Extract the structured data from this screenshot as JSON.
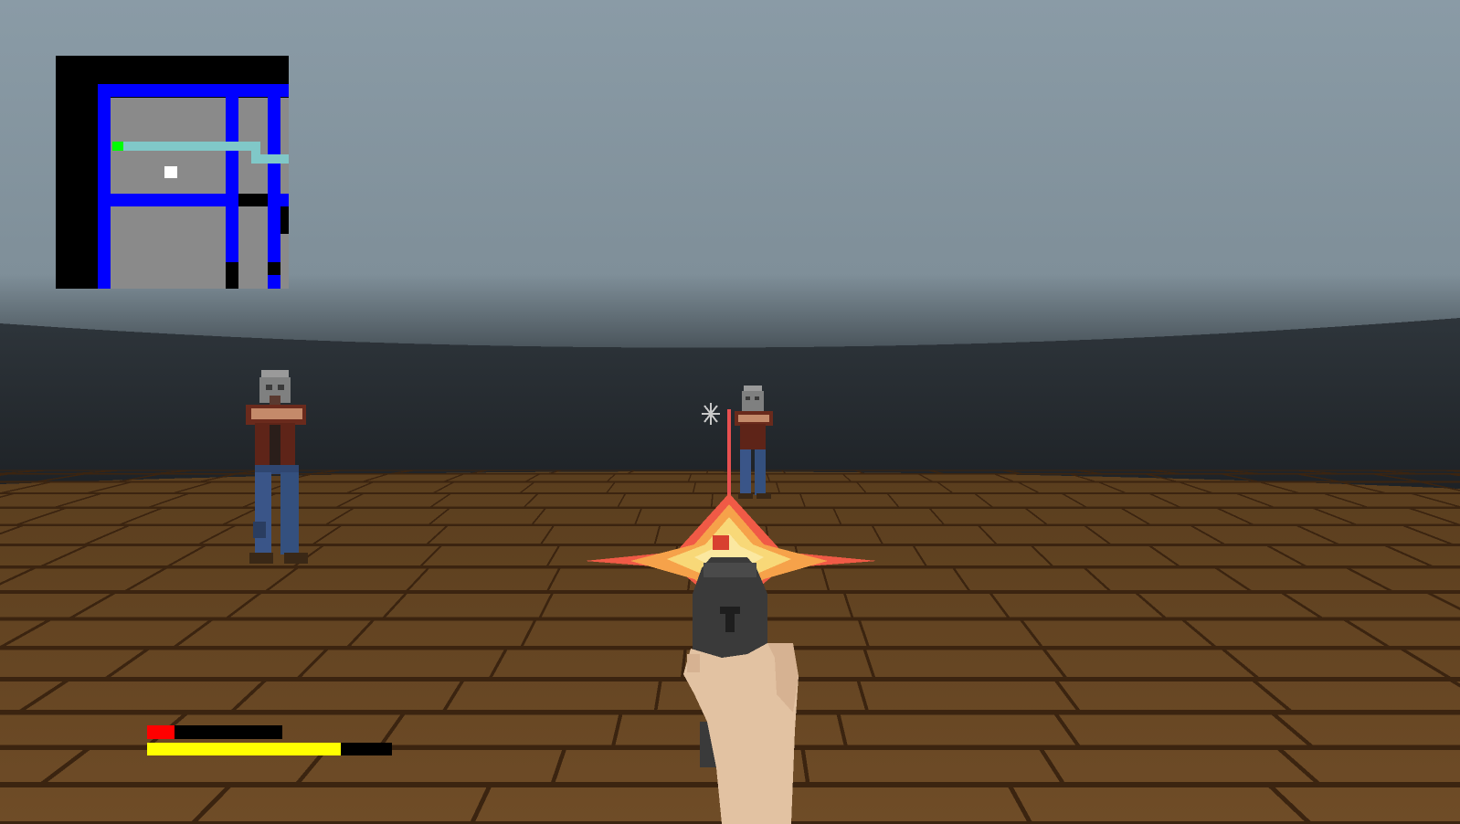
{
  "window": {
    "title": ""
  },
  "colors": {
    "sky": "#8fa0aa",
    "wall": "#2a2f34",
    "floor": "#6b4a25",
    "floor_lines": "#3b2410",
    "minimap_background": "#000000",
    "minimap_room": "#8a8a8a",
    "minimap_wall": "#0000ff",
    "minimap_path": "#80c8c8",
    "minimap_player": "#ffffff",
    "minimap_target": "#00ff00",
    "health": "#ff0000",
    "ammo": "#ffff00"
  },
  "hud": {
    "health": {
      "fraction": 0.2
    },
    "ammo": {
      "fraction": 0.79
    }
  },
  "minimap": {
    "icon": "minimap-icon"
  },
  "enemies": [
    {
      "name": "zombie"
    },
    {
      "name": "zombie"
    }
  ],
  "weapon": {
    "name": "pistol",
    "state": "firing",
    "icon": "pistol-icon"
  },
  "crosshair": {
    "icon": "crosshair-icon"
  }
}
